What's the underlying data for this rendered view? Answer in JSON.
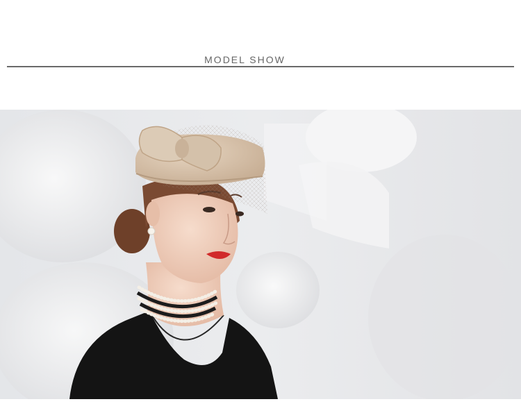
{
  "section": {
    "title": "MODEL SHOW"
  },
  "photo": {
    "subject": "model-wearing-beige-pillbox-hat",
    "palette": {
      "background": "#e8e9eb",
      "hat": "#d8c4ae",
      "hair": "#7a4a32",
      "skin": "#f0d2c0",
      "lips": "#d12a2a",
      "dress": "#141414",
      "pearl": "#f4efe6"
    }
  }
}
